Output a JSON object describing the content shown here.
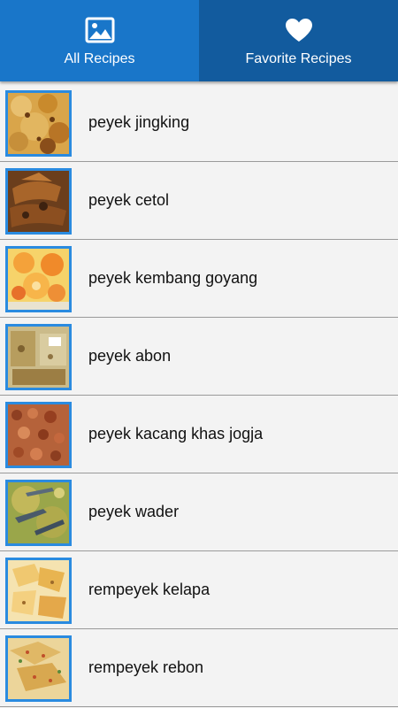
{
  "tabs": {
    "all": {
      "label": "All Recipes",
      "icon": "image-icon"
    },
    "favorite": {
      "label": "Favorite Recipes",
      "icon": "heart-icon"
    }
  },
  "colors": {
    "tab_active": "#1976c9",
    "tab_inactive": "#125b9e",
    "thumb_border": "#2a8be0",
    "list_bg": "#f3f3f3",
    "divider": "#9a9a9a"
  },
  "recipes": [
    {
      "title": "peyek jingking"
    },
    {
      "title": "peyek cetol"
    },
    {
      "title": "peyek kembang goyang"
    },
    {
      "title": "peyek abon"
    },
    {
      "title": "peyek kacang khas jogja"
    },
    {
      "title": "peyek wader"
    },
    {
      "title": "rempeyek kelapa"
    },
    {
      "title": "rempeyek rebon"
    }
  ]
}
